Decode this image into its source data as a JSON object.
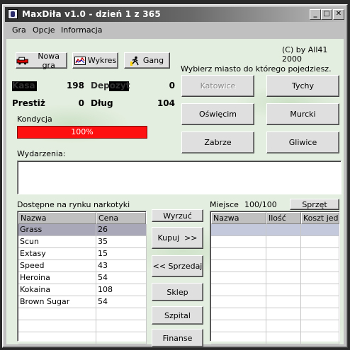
{
  "window": {
    "title": "MaxDiła v1.0 - dzień 1 z 365",
    "buttons": {
      "minimize": "_",
      "maximize": "□",
      "close": "✕"
    }
  },
  "menu": [
    "Gra",
    "Opcje",
    "Informacja"
  ],
  "copyright": "(C) by All41 2000",
  "toolbar": {
    "new_game": "Nowa gra",
    "chart": "Wykres",
    "gang": "Gang"
  },
  "stats": {
    "cash_label": "Kasa",
    "cash_value": "198",
    "deposit_label": "Depozyt",
    "deposit_value": "0",
    "prestige_label": "Prestiż",
    "prestige_value": "0",
    "debt_label": "Dług",
    "debt_value": "104"
  },
  "condition": {
    "label": "Kondycja",
    "value_text": "100%",
    "percent": 100,
    "color": "#ff1010"
  },
  "events": {
    "label": "Wydarzenia:",
    "text": ""
  },
  "cities": {
    "prompt": "Wybierz miasto do którego pojedziesz.",
    "items": [
      "Katowice",
      "Tychy",
      "Oświęcim",
      "Murcki",
      "Zabrze",
      "Gliwice"
    ],
    "disabled": "Katowice"
  },
  "market": {
    "label": "Dostępne na rynku narkotyki",
    "columns": [
      "Nazwa",
      "Cena"
    ],
    "rows": [
      [
        "Grass",
        "26"
      ],
      [
        "Scun",
        "35"
      ],
      [
        "Extasy",
        "15"
      ],
      [
        "Speed",
        "43"
      ],
      [
        "Heroina",
        "54"
      ],
      [
        "Kokaina",
        "108"
      ],
      [
        "Brown Sugar",
        "54"
      ]
    ],
    "selected_index": 0
  },
  "actions": {
    "dump": "Wyrzuć",
    "buy": "Kupuj  >>",
    "sell": "<< Sprzedaj",
    "shop": "Sklep",
    "hospital": "Szpital",
    "finance": "Finanse"
  },
  "inventory": {
    "space_label": "Miejsce",
    "space_value": "100/100",
    "gear_button": "Sprzęt",
    "columns": [
      "Nazwa",
      "Ilość",
      "Koszt jedn"
    ]
  }
}
